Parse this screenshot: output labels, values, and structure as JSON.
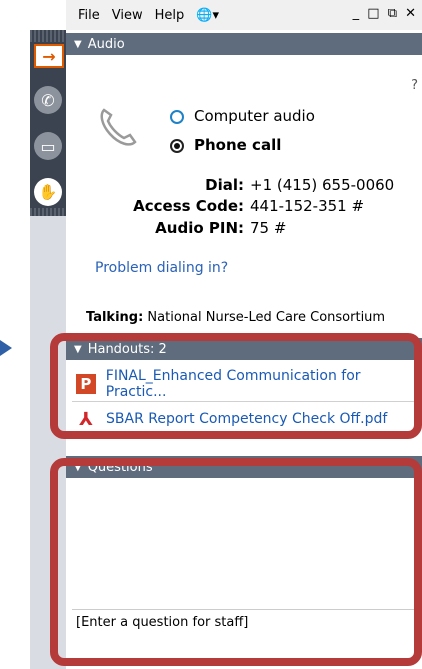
{
  "menubar": {
    "file": "File",
    "view": "View",
    "help": "Help",
    "globe_icon": "globe-icon",
    "window_controls": "_ □ ⧉ ✕"
  },
  "audio": {
    "title": "Audio",
    "help": "?",
    "option_computer": "Computer audio",
    "option_phone": "Phone call",
    "selected": "Phone call",
    "dial_label": "Dial:",
    "dial_value": "+1 (415) 655-0060",
    "access_label": "Access Code:",
    "access_value": "441-152-351 #",
    "pin_label": "Audio PIN:",
    "pin_value": "75 #",
    "problem_link": "Problem dialing in?",
    "talking_label": "Talking:",
    "talking_value": "National Nurse-Led Care Consortium"
  },
  "handouts": {
    "title": "Handouts: 2",
    "items": [
      {
        "icon": "powerpoint-icon",
        "label": "FINAL_Enhanced Communication for Practic..."
      },
      {
        "icon": "pdf-icon",
        "label": "SBAR Report Competency Check Off.pdf"
      }
    ]
  },
  "questions": {
    "title": "Questions",
    "placeholder": "[Enter a question for staff]"
  },
  "colors": {
    "accent": "#b53b3b",
    "header": "#5f6c7d",
    "link": "#2a62b8",
    "rail": "#3b4350"
  }
}
